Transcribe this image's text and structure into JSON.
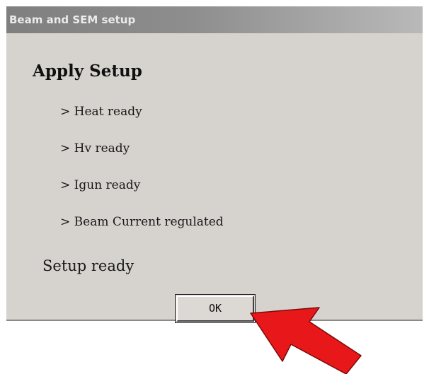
{
  "window": {
    "title": "Beam and SEM setup"
  },
  "content": {
    "heading": "Apply Setup",
    "status_items": [
      "> Heat ready",
      "> Hv ready",
      "> Igun ready",
      "> Beam Current regulated"
    ],
    "setup_status": "Setup ready"
  },
  "buttons": {
    "ok_label": "OK"
  },
  "annotation": {
    "arrow_icon": "red-pointer-arrow-icon",
    "arrow_color": "#e8171a"
  },
  "colors": {
    "dialog_background": "#d6d3ce",
    "titlebar_gradient_start": "#7f7f7f",
    "titlebar_gradient_end": "#b9b9b9"
  }
}
